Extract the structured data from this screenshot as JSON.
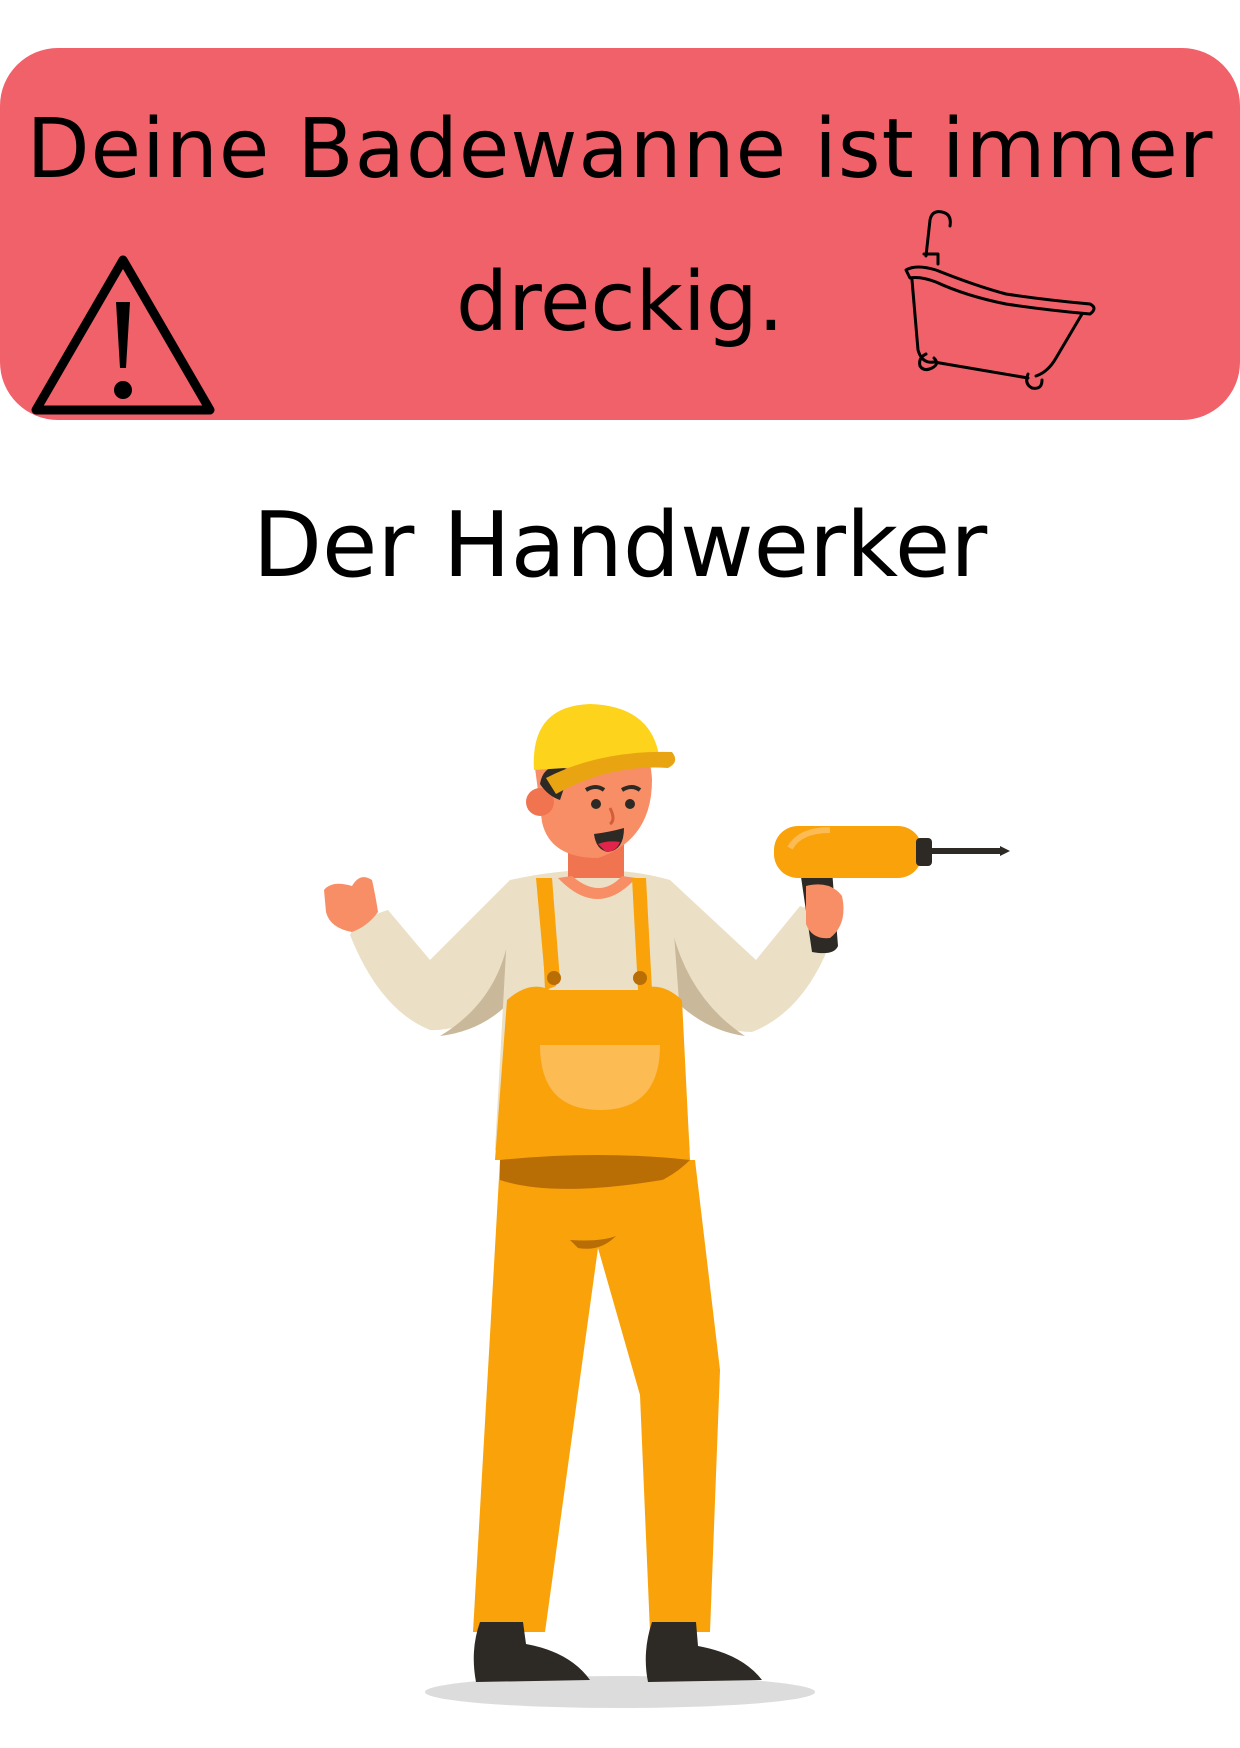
{
  "banner": {
    "line1": "Deine Badewanne ist immer",
    "line2": "dreckig.",
    "background_color": "#f1616a",
    "icons": [
      "warning-icon",
      "bathtub-icon"
    ]
  },
  "subtitle": "Der Handwerker",
  "illustration": {
    "subject": "worker-illustration",
    "colors": {
      "overalls": "#f9a20a",
      "helmet": "#fdd31c",
      "shirt": "#ebe0c5",
      "skin": "#f88e65"
    }
  }
}
